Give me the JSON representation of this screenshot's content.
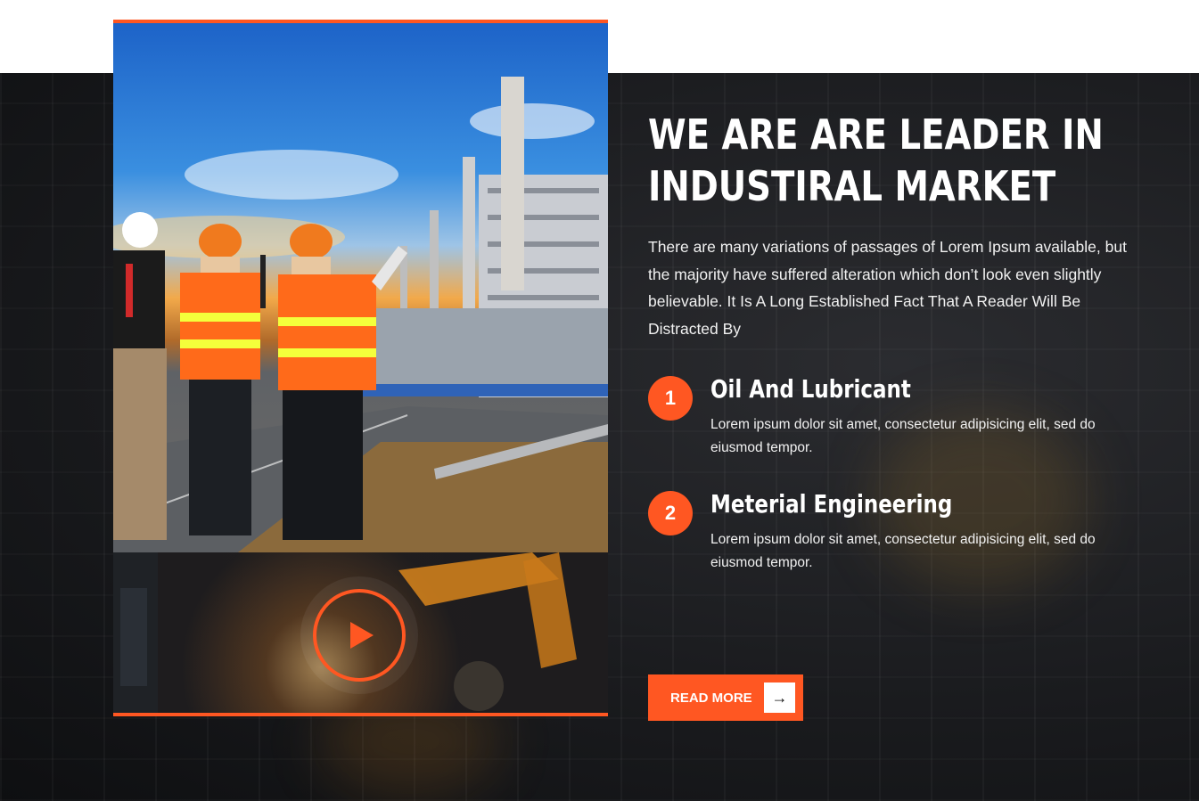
{
  "section": {
    "headline_line1": "WE ARE ARE LEADER IN",
    "headline_line2": "INDUSTIRAL MARKET",
    "intro": "There are many variations of passages of Lorem Ipsum available, but the majority have suffered alteration which don’t look even slightly believable. It Is A Long Established Fact That A Reader Will Be Distracted By"
  },
  "features": [
    {
      "number": "1",
      "title": "Oil And Lubricant",
      "text": "Lorem ipsum dolor sit amet, consectetur adipisicing elit, sed do eiusmod tempor."
    },
    {
      "number": "2",
      "title": "Meterial Engineering",
      "text": "Lorem ipsum dolor sit amet, consectetur adipisicing elit, sed do eiusmod tempor."
    }
  ],
  "cta": {
    "label": "READ MORE",
    "icon": "arrow-right-icon"
  },
  "media": {
    "image_icon": "industrial-workers-image",
    "video_icon": "play-icon"
  },
  "colors": {
    "accent": "#ff5722",
    "background": "#1a1b1e",
    "text": "#ffffff"
  }
}
